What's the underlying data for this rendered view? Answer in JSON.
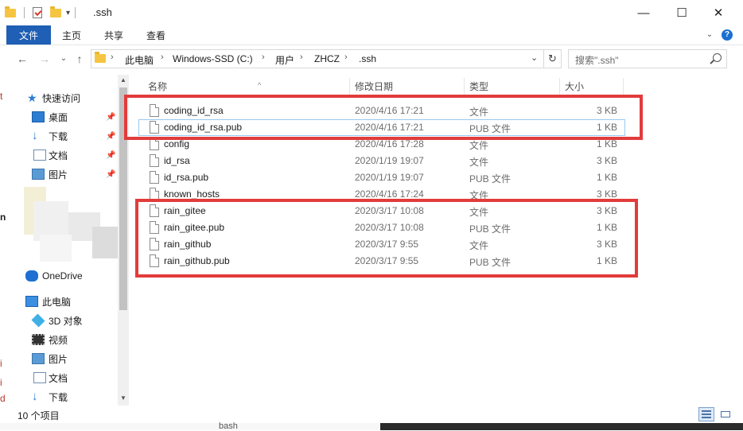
{
  "window": {
    "title": ".ssh",
    "minimize_label": "—",
    "maximize_label": "☐",
    "close_label": "✕"
  },
  "ribbon": {
    "tabs": [
      "文件",
      "主页",
      "共享",
      "查看"
    ],
    "help_label": "?"
  },
  "address": {
    "crumbs": [
      "此电脑",
      "Windows-SSD (C:)",
      "用户",
      "ZHCZ",
      ".ssh"
    ],
    "separator": "›",
    "search_placeholder": "搜索\".ssh\""
  },
  "nav": {
    "quick_access": "快速访问",
    "quick_items": [
      "桌面",
      "下载",
      "文档",
      "图片"
    ],
    "onedrive": "OneDrive",
    "this_pc": "此电脑",
    "pc_items": [
      "3D 对象",
      "视频",
      "图片",
      "文档",
      "下载"
    ]
  },
  "columns": {
    "name": "名称",
    "modified": "修改日期",
    "type": "类型",
    "size": "大小"
  },
  "files": [
    {
      "name": "coding_id_rsa",
      "modified": "2020/4/16 17:21",
      "type": "文件",
      "size": "3 KB"
    },
    {
      "name": "coding_id_rsa.pub",
      "modified": "2020/4/16 17:21",
      "type": "PUB 文件",
      "size": "1 KB"
    },
    {
      "name": "config",
      "modified": "2020/4/16 17:28",
      "type": "文件",
      "size": "1 KB"
    },
    {
      "name": "id_rsa",
      "modified": "2020/1/19 19:07",
      "type": "文件",
      "size": "3 KB"
    },
    {
      "name": "id_rsa.pub",
      "modified": "2020/1/19 19:07",
      "type": "PUB 文件",
      "size": "1 KB"
    },
    {
      "name": "known_hosts",
      "modified": "2020/4/16 17:24",
      "type": "文件",
      "size": "3 KB"
    },
    {
      "name": "rain_gitee",
      "modified": "2020/3/17 10:08",
      "type": "文件",
      "size": "3 KB"
    },
    {
      "name": "rain_gitee.pub",
      "modified": "2020/3/17 10:08",
      "type": "PUB 文件",
      "size": "1 KB"
    },
    {
      "name": "rain_github",
      "modified": "2020/3/17 9:55",
      "type": "文件",
      "size": "3 KB"
    },
    {
      "name": "rain_github.pub",
      "modified": "2020/3/17 9:55",
      "type": "PUB 文件",
      "size": "1 KB"
    }
  ],
  "status": {
    "item_count": "10 个项目"
  },
  "background": {
    "taskbar_word": "bash"
  },
  "colors": {
    "file_tab": "#1f5fb5",
    "highlight_box": "#e33b3b",
    "selection_border": "#99c9ef"
  }
}
